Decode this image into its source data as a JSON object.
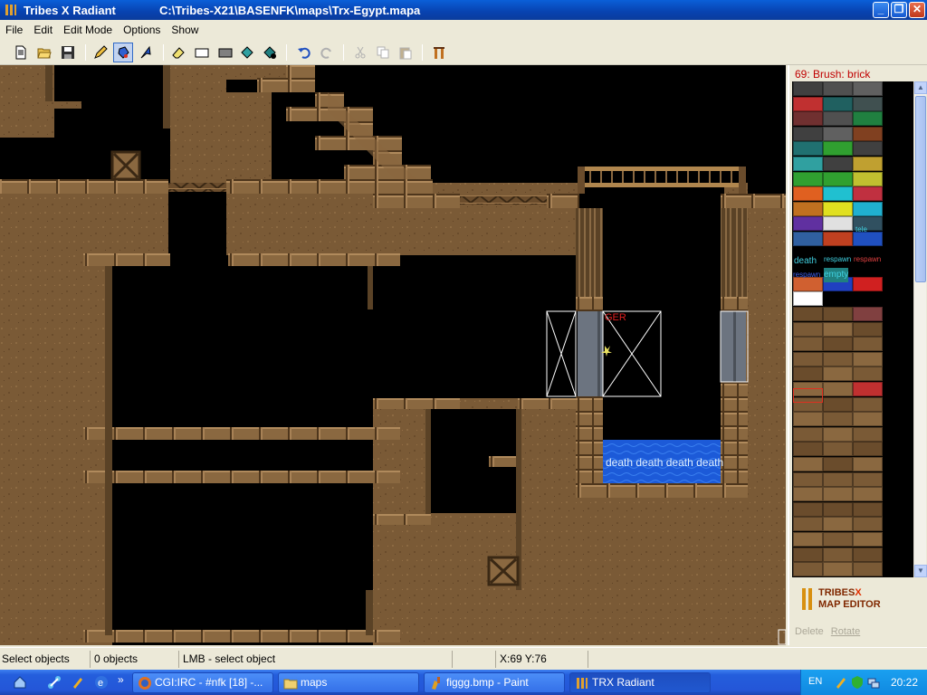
{
  "window": {
    "app_name": "Tribes X Radiant",
    "file_path": "C:\\Tribes-X21\\BASENFK\\maps\\Trx-Egypt.mapa",
    "buttons": [
      "_",
      "❐",
      "✕"
    ]
  },
  "menu": [
    "File",
    "Edit",
    "Edit Mode",
    "Options",
    "Show"
  ],
  "toolbar": {
    "icons": [
      "new-file-icon",
      "open-folder-icon",
      "save-disk-icon",
      "pencil-icon",
      "paint-bucket-icon",
      "select-arrow-icon",
      "eraser-icon",
      "rectangle-icon",
      "filled-rectangle-icon",
      "tiles-icon",
      "tiles-fill-icon",
      "undo-icon",
      "redo-icon",
      "cut-icon",
      "copy-icon",
      "paste-icon",
      "bar-icon"
    ],
    "active": "paint-bucket-icon"
  },
  "canvas": {
    "overlay_texts": {
      "trigger_label": "GER",
      "death_label": "death death death death"
    }
  },
  "panel": {
    "brush_title": "69: Brush: brick",
    "palette_labels": {
      "death": "death",
      "respawn1": "respawn",
      "respawn2": "respawn",
      "respawn3": "respawn",
      "empty": "empty",
      "tele": "tele"
    },
    "logo_line1_a": "TRIBES",
    "logo_line1_b": "X",
    "logo_line2": "MAP EDITOR",
    "action_delete": "Delete",
    "action_rotate": "Rotate"
  },
  "statusbar": {
    "mode": "Select objects",
    "count": "0 objects",
    "hint": "LMB - select object",
    "coords": "X:69 Y:76"
  },
  "taskbar": {
    "tasks": [
      {
        "label": "CGI:IRC - #nfk [18] -...",
        "active": false
      },
      {
        "label": "maps",
        "active": false
      },
      {
        "label": "figgg.bmp - Paint",
        "active": false
      },
      {
        "label": "TRX Radiant",
        "active": true
      }
    ],
    "language": "EN",
    "clock": "20:22"
  },
  "colors": {
    "brick": "#7a5a36",
    "brick_light": "#a07a4e",
    "brick_dark": "#4a341c",
    "water": "#1a5ad8",
    "trigger_text": "#e02020"
  }
}
